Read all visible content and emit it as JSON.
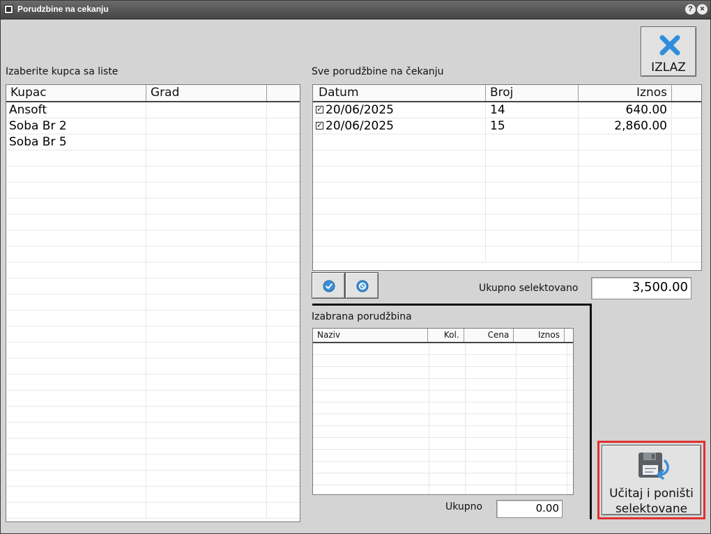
{
  "window": {
    "title": "Porudzbine na cekanju"
  },
  "titlebar": {
    "help": "?",
    "close": "×"
  },
  "exit_button": {
    "label": "IZLAZ"
  },
  "customers": {
    "section_label": "Izaberite kupca sa liste",
    "columns": [
      "Kupac",
      "Grad"
    ],
    "rows": [
      {
        "kupac": "Ansoft",
        "grad": ""
      },
      {
        "kupac": "Soba Br 2",
        "grad": ""
      },
      {
        "kupac": "Soba Br 5",
        "grad": ""
      }
    ]
  },
  "orders": {
    "section_label": "Sve porudžbine na čekanju",
    "columns": [
      "Datum",
      "Broj",
      "Iznos"
    ],
    "rows": [
      {
        "checked": true,
        "datum": "20/06/2025",
        "broj": "14",
        "iznos": "640.00"
      },
      {
        "checked": true,
        "datum": "20/06/2025",
        "broj": "15",
        "iznos": "2,860.00"
      }
    ]
  },
  "selection": {
    "total_label": "Ukupno selektovano",
    "total_value": "3,500.00"
  },
  "order_detail": {
    "section_label": "Izabrana porudžbina",
    "columns": [
      "Naziv",
      "Kol.",
      "Cena",
      "Iznos"
    ],
    "total_label": "Ukupno",
    "total_value": "0.00"
  },
  "load_button": {
    "line1": "Učitaj i poništi",
    "line2": "selektovane"
  },
  "colors": {
    "highlight": "#e03030",
    "icon_blue": "#3b8fd8"
  }
}
